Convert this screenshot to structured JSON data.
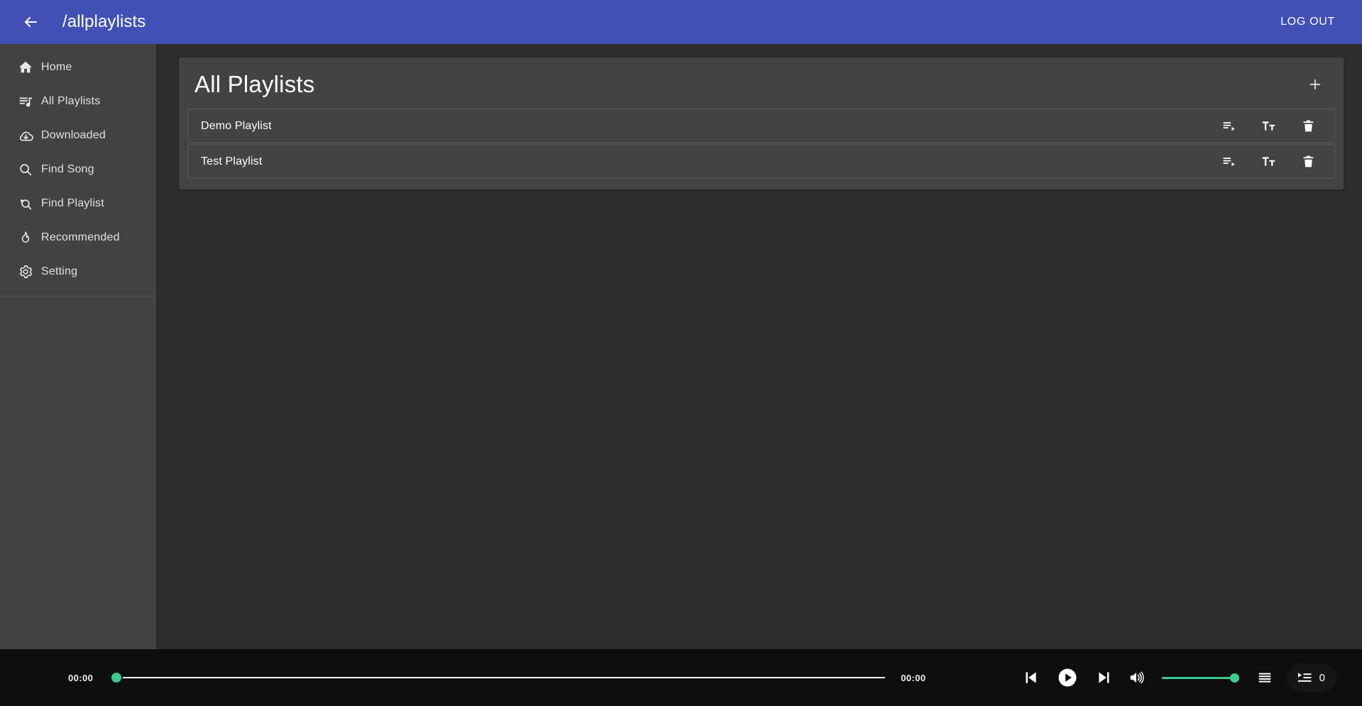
{
  "topbar": {
    "back_icon": "arrow-back-icon",
    "title": "/allplaylists",
    "logout_label": "LOG OUT",
    "background_color": "#4050b5"
  },
  "sidebar": {
    "background_color": "#424242",
    "items": [
      {
        "label": "Home",
        "icon": "home-icon"
      },
      {
        "label": "All Playlists",
        "icon": "queue-music-icon"
      },
      {
        "label": "Downloaded",
        "icon": "cloud-download-icon"
      },
      {
        "label": "Find Song",
        "icon": "search-icon"
      },
      {
        "label": "Find Playlist",
        "icon": "search-playlist-icon"
      },
      {
        "label": "Recommended",
        "icon": "flame-icon"
      },
      {
        "label": "Setting",
        "icon": "gear-icon"
      }
    ]
  },
  "main": {
    "card_title": "All Playlists",
    "add_button_icon": "plus-icon",
    "row_actions": [
      {
        "icon": "playlist-play-icon",
        "name": "play-playlist-button"
      },
      {
        "icon": "rename-text-icon",
        "name": "rename-playlist-button"
      },
      {
        "icon": "trash-icon",
        "name": "delete-playlist-button"
      }
    ],
    "playlists": [
      {
        "name": "Demo Playlist"
      },
      {
        "name": "Test Playlist"
      }
    ]
  },
  "player": {
    "background_color": "#0e0e0e",
    "accent_color": "#3ccb8b",
    "current_time": "00:00",
    "total_time": "00:00",
    "seek_progress_percent": 0,
    "volume_percent": 100,
    "queue_count": "0",
    "controls": [
      {
        "icon": "skip-previous-icon",
        "name": "previous-track-button"
      },
      {
        "icon": "play-icon",
        "name": "play-button"
      },
      {
        "icon": "skip-next-icon",
        "name": "next-track-button"
      },
      {
        "icon": "volume-up-icon",
        "name": "volume-button"
      },
      {
        "icon": "equalizer-icon",
        "name": "equalizer-button"
      },
      {
        "icon": "queue-icon",
        "name": "queue-button"
      }
    ]
  }
}
